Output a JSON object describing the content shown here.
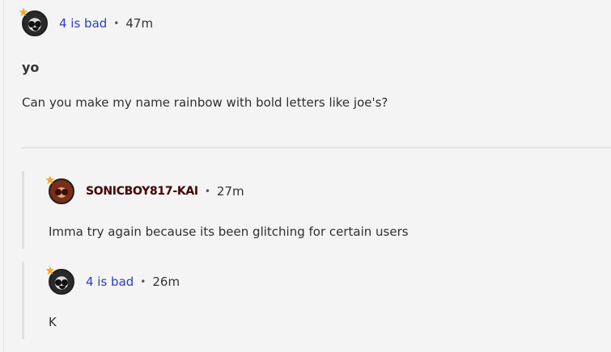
{
  "post": {
    "author": "4 is bad",
    "separator": "•",
    "time": "47m",
    "title": "yo",
    "body": "Can you make my name rainbow with bold letters like joe's?"
  },
  "replies": [
    {
      "author": "SONICBOY817-KAI",
      "separator": "•",
      "time": "27m",
      "body": "Imma try again because its been glitching for certain users"
    },
    {
      "author": "4 is bad",
      "separator": "•",
      "time": "26m",
      "body": "K"
    }
  ],
  "icons": {
    "badge": "star-badge-icon",
    "avatar": "profile-avatar-icon"
  },
  "colors": {
    "username_link": "#2a3ec4",
    "badge": "#f5a623",
    "background": "#f4f4f4"
  }
}
